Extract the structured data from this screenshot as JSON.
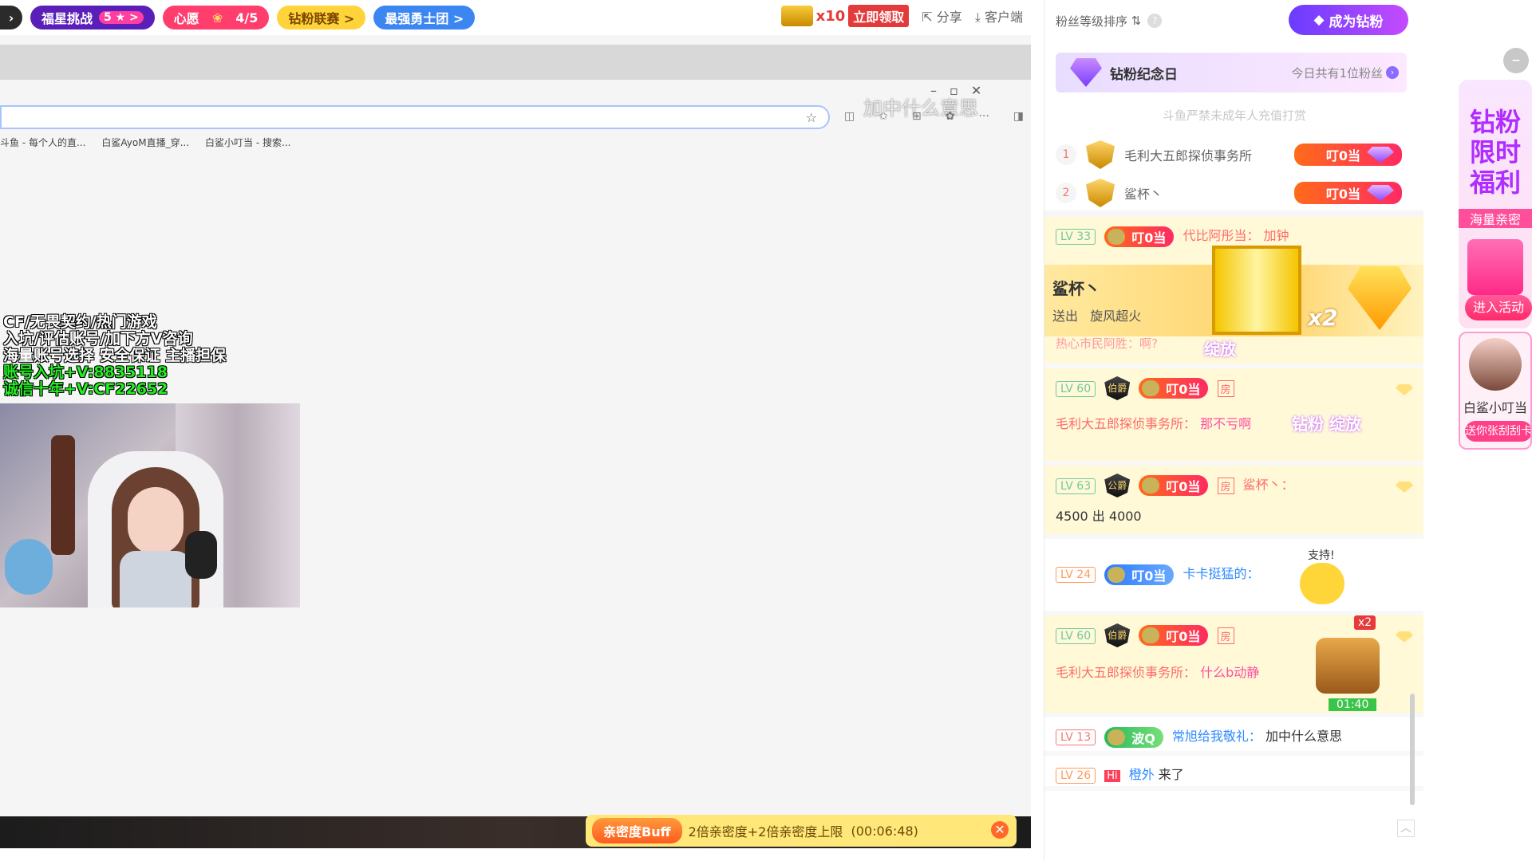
{
  "topbar": {
    "star_challenge": {
      "label": "福星挑战",
      "count": "5 ★ >"
    },
    "wish": {
      "label": "心愿",
      "progress": "4/5"
    },
    "diamond_league": {
      "label": "钻粉联赛 >"
    },
    "bravest_team": {
      "label": "最强勇士团 >"
    },
    "promo": {
      "multiplier": "x10",
      "cta": "立即领取"
    },
    "share_label": "分享",
    "client_label": "客户端"
  },
  "browser": {
    "overlay_caption": "加中什么意思",
    "bookmarks": [
      "斗鱼 - 每个人的直...",
      "白鲨AyoM直播_穿...",
      "白鲨小叮当 - 搜索..."
    ]
  },
  "stream_overlay": {
    "lines": [
      "CF/无畏契约/热门游戏",
      "入坑/评估账号/加下方V咨询",
      "海量账号选择 安全保证 主播担保"
    ],
    "green_lines": [
      "账号入坑+V:8835118",
      "诚信十年+V:CF22652"
    ]
  },
  "buff_bar": {
    "tag": "亲密度Buff",
    "text": "2倍亲密度+2倍亲密度上限",
    "timer": "(00:06:48)"
  },
  "right_panel": {
    "sort_label": "粉丝等级排序",
    "become_button": "成为钻粉",
    "anniversary": {
      "title": "钻粉纪念日",
      "today": "今日共有1位粉丝"
    },
    "notice": "斗鱼严禁未成年人充值打赏",
    "ranking": [
      {
        "rank": "1",
        "name": "毛利大五郎探侦事务所",
        "badge": "叮0当"
      },
      {
        "rank": "2",
        "name": "鲨杯丶",
        "badge": "叮0当"
      }
    ]
  },
  "gift_banner": {
    "sender": "鲨杯丶",
    "action": "送出",
    "gift": "旋风超火",
    "times": "x2"
  },
  "chat": [
    {
      "lv": "LV 33",
      "badge": "叮0当",
      "name": "代比阿彤当：",
      "content": "加钟",
      "partial": "热心市民阿胜：啊?",
      "gift_text": "绽放"
    },
    {
      "lv": "LV 60",
      "tag": "伯爵",
      "badge": "叮0当",
      "room": "房",
      "name": "毛利大五郎探侦事务所：",
      "content": "那不亏啊",
      "gift_text": "钻粉 绽放"
    },
    {
      "lv": "LV 63",
      "tag": "公爵",
      "badge": "叮0当",
      "room": "房",
      "name": "鲨杯丶：",
      "content": "4500 出 4000"
    },
    {
      "lv": "LV 24",
      "badge": "叮0当",
      "name": "卡卡挺猛的：",
      "content": "",
      "sticker": "支持!"
    },
    {
      "lv": "LV 60",
      "tag": "伯爵",
      "badge": "叮0当",
      "room": "房",
      "name": "毛利大五郎探侦事务所：",
      "content": "什么b动静",
      "box_count": "x2",
      "timer": "01:40"
    },
    {
      "lv": "LV 13",
      "badge": "波Q",
      "name": "常旭给我敬礼：",
      "content": "加中什么意思"
    },
    {
      "lv": "LV 26",
      "hi": "Hi",
      "name": "橙外",
      "content": "来了"
    }
  ],
  "side_promo": {
    "headline": "钻粉限时福利",
    "sub": "海量亲密",
    "button": "进入活动",
    "streamer_name": "白鲨小叮当",
    "streamer_cta": "送你张刮刮卡"
  },
  "colors": {
    "accent": "#ff6a2a",
    "purple": "#6a3cff",
    "badge_orange": "#ff6b1a",
    "lv_green": "#6ec9a0"
  }
}
